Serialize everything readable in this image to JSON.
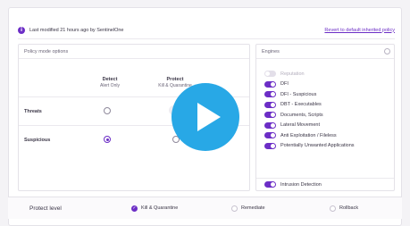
{
  "banner": {
    "modified_text": "Last modified 21 hours ago by SentinelOne",
    "revert_link": "Revert to default inherited policy",
    "info_icon": "info-icon"
  },
  "policy_panel": {
    "title": "Policy mode options",
    "columns": [
      {
        "label": "Detect",
        "sub": "Alert Only"
      },
      {
        "label": "Protect",
        "sub": "Kill & Quarantine"
      }
    ],
    "rows": [
      {
        "label": "Threats",
        "detect_selected": false,
        "protect_selected": true
      },
      {
        "label": "Suspicious",
        "detect_selected": true,
        "protect_selected": false
      }
    ]
  },
  "engines": {
    "title": "Engines",
    "settings_icon": "gear-icon",
    "items": [
      {
        "label": "Reputation",
        "enabled": false
      },
      {
        "label": "DFI",
        "enabled": true
      },
      {
        "label": "DFI - Suspicious",
        "enabled": true
      },
      {
        "label": "DBT - Executables",
        "enabled": true
      },
      {
        "label": "Documents, Scripts",
        "enabled": true
      },
      {
        "label": "Lateral Movement",
        "enabled": true
      },
      {
        "label": "Anti Exploitation / Fileless",
        "enabled": true
      },
      {
        "label": "Potentially Unwanted Applications",
        "enabled": true
      }
    ],
    "intrusion": {
      "label": "Intrusion Detection",
      "enabled": true
    }
  },
  "protect_level": {
    "label": "Protect level",
    "options": [
      {
        "label": "Kill & Quarantine",
        "selected": true
      },
      {
        "label": "Remediate",
        "selected": false
      },
      {
        "label": "Rollback",
        "selected": false
      }
    ]
  },
  "overlay": {
    "icon": "play-icon",
    "color": "#28a8e6"
  },
  "colors": {
    "accent": "#6c2ec6",
    "text": "#3a3546",
    "muted": "#6b6578"
  }
}
